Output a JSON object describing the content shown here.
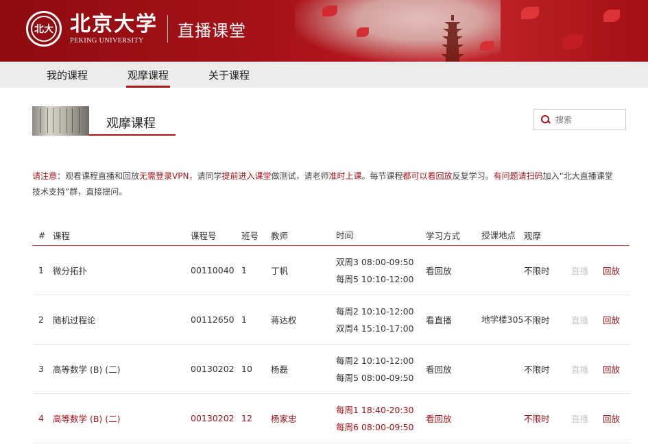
{
  "header": {
    "brand_cn": "北京大学",
    "brand_en": "PEKING UNIVERSITY",
    "portal_title": "直播课堂",
    "seal_text": "北大"
  },
  "nav": {
    "items": [
      {
        "label": "我的课程"
      },
      {
        "label": "观摩课程"
      },
      {
        "label": "关于课程"
      }
    ],
    "active_index": 1
  },
  "section": {
    "title": "观摩课程"
  },
  "search": {
    "placeholder": "搜索"
  },
  "notice": {
    "parts": [
      {
        "text": "请注意",
        "red": true
      },
      {
        "text": "：观看课程直播和回放",
        "red": false
      },
      {
        "text": "无需登录VPN",
        "red": true
      },
      {
        "text": "，请同学",
        "red": false
      },
      {
        "text": "提前进入课堂",
        "red": true
      },
      {
        "text": "做测试，请老师",
        "red": false
      },
      {
        "text": "准时上课",
        "red": true
      },
      {
        "text": "。每节课程",
        "red": false
      },
      {
        "text": "都可以看回放",
        "red": true
      },
      {
        "text": "反复学习。",
        "red": false
      },
      {
        "text": "有问题请扫码",
        "red": true
      },
      {
        "text": "加入“北大直播课堂技术支持”群，直接提问。",
        "red": false
      }
    ]
  },
  "table": {
    "headers": [
      "#",
      "课程",
      "课程号",
      "班号",
      "教师",
      "时间",
      "学习方式",
      "授课地点",
      "观摩",
      "",
      ""
    ],
    "rows": [
      {
        "num": "1",
        "course": "微分拓扑",
        "code": "00110040",
        "class": "1",
        "teacher": "丁帆",
        "time1": "双周3  08:00-09:50",
        "time2": "每周5  10:10-12:00",
        "mode": "看回放",
        "location": "",
        "observe": "不限时",
        "live": "直播",
        "replay": "回放",
        "highlight": false
      },
      {
        "num": "2",
        "course": "随机过程论",
        "code": "00112650",
        "class": "1",
        "teacher": "蒋达权",
        "time1": "每周2  10:10-12:00",
        "time2": "双周4  15:10-17:00",
        "mode": "看直播",
        "location": "地学楼305",
        "observe": "不限时",
        "live": "直播",
        "replay": "回放",
        "highlight": false
      },
      {
        "num": "3",
        "course": "高等数学 (B) (二)",
        "code": "00130202",
        "class": "10",
        "teacher": "杨磊",
        "time1": "每周2  10:10-12:00",
        "time2": "每周5  08:00-09:50",
        "mode": "看回放",
        "location": "",
        "observe": "不限时",
        "live": "直播",
        "replay": "回放",
        "highlight": false
      },
      {
        "num": "4",
        "course": "高等数学 (B) (二)",
        "code": "00130202",
        "class": "12",
        "teacher": "杨家忠",
        "time1": "每周1  18:40-20:30",
        "time2": "每周6  08:00-09:50",
        "mode": "看回放",
        "location": "",
        "observe": "不限时",
        "live": "直播",
        "replay": "回放",
        "highlight": true
      }
    ]
  },
  "colors": {
    "brand_red": "#a51218",
    "nav_bg": "#ececec",
    "disabled_text": "#c8c8c8"
  }
}
